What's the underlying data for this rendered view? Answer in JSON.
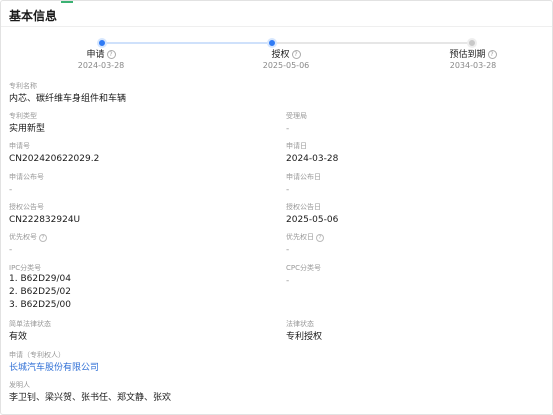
{
  "section": {
    "title": "基本信息"
  },
  "timeline": {
    "steps": [
      {
        "label": "申请",
        "date": "2024-03-28"
      },
      {
        "label": "授权",
        "date": "2025-05-06"
      },
      {
        "label": "预估到期",
        "date": "2034-03-28"
      }
    ]
  },
  "fields": {
    "patent_name": {
      "label": "专利名称",
      "value": "内芯、碳纤维车身组件和车辆"
    },
    "patent_type": {
      "label": "专利类型",
      "value": "实用新型"
    },
    "office": {
      "label": "受理局",
      "value": "-"
    },
    "app_number": {
      "label": "申请号",
      "value": "CN202420622029.2"
    },
    "app_date": {
      "label": "申请日",
      "value": "2024-03-28"
    },
    "pub_number": {
      "label": "申请公布号",
      "value": "-"
    },
    "pub_date": {
      "label": "申请公布日",
      "value": "-"
    },
    "grant_number": {
      "label": "授权公告号",
      "value": "CN222832924U"
    },
    "grant_date": {
      "label": "授权公告日",
      "value": "2025-05-06"
    },
    "priority_number": {
      "label": "优先权号",
      "value": "-"
    },
    "priority_date": {
      "label": "优先权日",
      "value": "-"
    },
    "ipc": {
      "label": "IPC分类号",
      "values": [
        "1. B62D29/04",
        "2. B62D25/02",
        "3. B62D25/00"
      ]
    },
    "cpc": {
      "label": "CPC分类号",
      "value": "-"
    },
    "simple_status": {
      "label": "简单法律状态",
      "value": "有效"
    },
    "legal_status": {
      "label": "法律状态",
      "value": "专利授权"
    },
    "applicant": {
      "label": "申请（专利权人）",
      "value": "长城汽车股份有限公司"
    },
    "inventors": {
      "label": "发明人",
      "value": "李卫钊、梁兴贺、张书任、郑文静、张欢"
    }
  },
  "icons": {
    "help": "question-circle-icon"
  },
  "colors": {
    "accent": "#2f7bf5",
    "link": "#2f6fd6",
    "tab_accent": "#3bb273"
  }
}
